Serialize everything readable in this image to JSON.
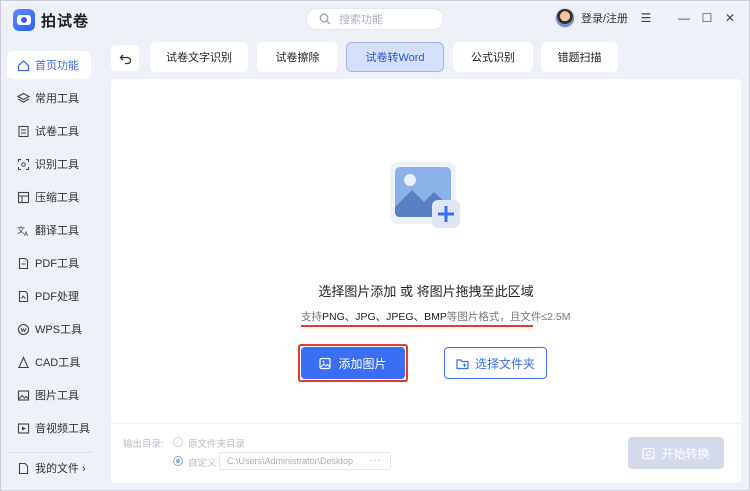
{
  "app": {
    "title": "拍试卷"
  },
  "search": {
    "placeholder": "搜索功能"
  },
  "user": {
    "login_label": "登录/注册"
  },
  "window_controls": {
    "menu": "☰",
    "minimize": "—",
    "maximize": "☐",
    "close": "✕"
  },
  "sidebar": {
    "items": [
      {
        "label": "首页功能",
        "icon": "home-icon",
        "active": true
      },
      {
        "label": "常用工具",
        "icon": "layers-icon"
      },
      {
        "label": "试卷工具",
        "icon": "document-icon"
      },
      {
        "label": "识别工具",
        "icon": "scan-icon"
      },
      {
        "label": "压缩工具",
        "icon": "compress-icon"
      },
      {
        "label": "翻译工具",
        "icon": "translate-icon"
      },
      {
        "label": "PDF工具",
        "icon": "pdf-icon"
      },
      {
        "label": "PDF处理",
        "icon": "pdf-process-icon"
      },
      {
        "label": "WPS工具",
        "icon": "wps-icon"
      },
      {
        "label": "CAD工具",
        "icon": "cad-icon"
      },
      {
        "label": "图片工具",
        "icon": "image-icon"
      },
      {
        "label": "音视频工具",
        "icon": "media-icon"
      }
    ],
    "my_files": "我的文件 ›"
  },
  "tabs": [
    {
      "label": "试卷文字识别"
    },
    {
      "label": "试卷擦除"
    },
    {
      "label": "试卷转Word",
      "active": true
    },
    {
      "label": "公式识别"
    },
    {
      "label": "错题扫描"
    }
  ],
  "drop": {
    "title": "选择图片添加 或 将图片拖拽至此区域",
    "support_prefix": "支持",
    "support_formats": "PNG、JPG、JPEG、BMP",
    "support_suffix": "等图片格式，且文件≤2.5M"
  },
  "buttons": {
    "add_image": "添加图片",
    "select_folder": "选择文件夹",
    "start_convert": "开始转换"
  },
  "output": {
    "label": "输出目录:",
    "option_source": "原文件夹目录",
    "option_custom": "自定义",
    "path": "C:\\Users\\Administrator\\Desktop",
    "more": "···"
  },
  "colors": {
    "accent": "#3a6ef3",
    "highlight": "#e53935",
    "disabled": "#d5daea"
  }
}
